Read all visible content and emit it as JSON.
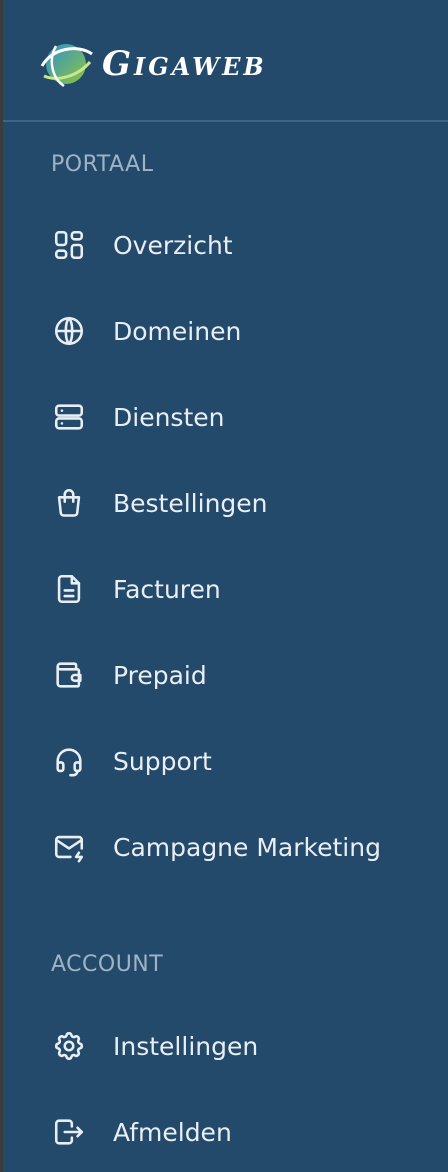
{
  "brand": {
    "name": "Gigaweb",
    "colors": {
      "background": "#23496b",
      "text": "#e9eef3",
      "section": "#9fb3c6",
      "logo_green": "#8dc63f",
      "logo_blue": "#2e8fcf"
    }
  },
  "sections": [
    {
      "label": "PORTAAL",
      "items": [
        {
          "label": "Overzicht",
          "icon": "dashboard-icon"
        },
        {
          "label": "Domeinen",
          "icon": "globe-icon"
        },
        {
          "label": "Diensten",
          "icon": "server-icon"
        },
        {
          "label": "Bestellingen",
          "icon": "shopping-bag-icon"
        },
        {
          "label": "Facturen",
          "icon": "document-icon"
        },
        {
          "label": "Prepaid",
          "icon": "wallet-icon"
        },
        {
          "label": "Support",
          "icon": "headset-icon"
        },
        {
          "label": "Campagne Marketing",
          "icon": "mail-bolt-icon"
        }
      ]
    },
    {
      "label": "ACCOUNT",
      "items": [
        {
          "label": "Instellingen",
          "icon": "gear-icon"
        },
        {
          "label": "Afmelden",
          "icon": "logout-icon"
        }
      ]
    }
  ]
}
